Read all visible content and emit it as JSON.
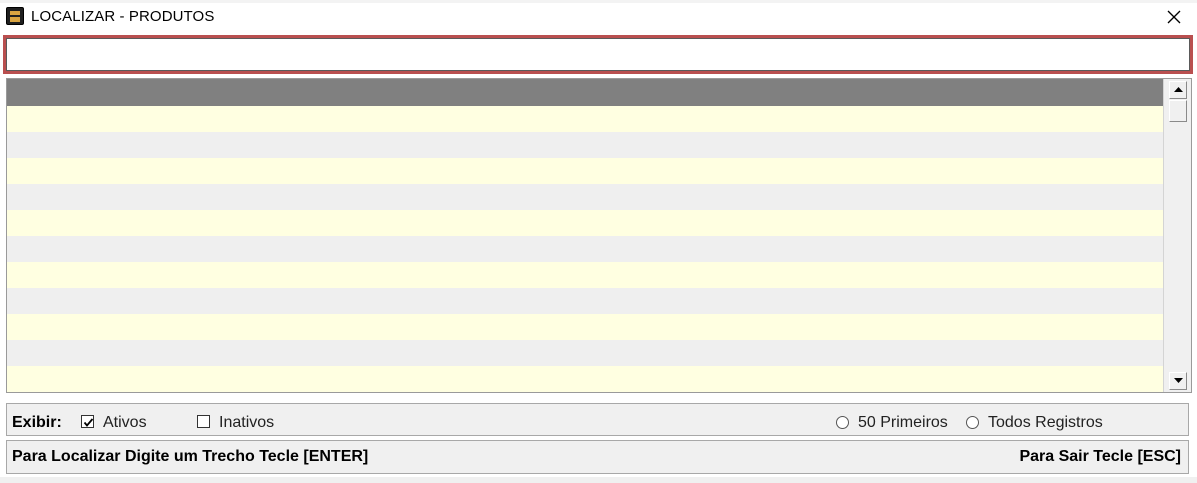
{
  "window": {
    "title": "LOCALIZAR - PRODUTOS",
    "icon": "app-icon",
    "close_icon": "close-icon"
  },
  "search": {
    "value": "",
    "border_color": "#b94f4f"
  },
  "grid": {
    "header_color": "#808080",
    "row_colors": [
      "#ffffe1",
      "#efefef"
    ],
    "rows": [
      "",
      "",
      "",
      "",
      "",
      "",
      "",
      "",
      "",
      "",
      "",
      ""
    ]
  },
  "options": {
    "label": "Exibir:",
    "active_label": "Ativos",
    "active_checked": true,
    "inactive_label": "Inativos",
    "inactive_checked": false,
    "first50_label": "50 Primeiros",
    "all_label": "Todos Registros"
  },
  "status": {
    "left_hint": "Para Localizar Digite um Trecho Tecle [ENTER]",
    "right_hint": "Para Sair Tecle [ESC]"
  }
}
